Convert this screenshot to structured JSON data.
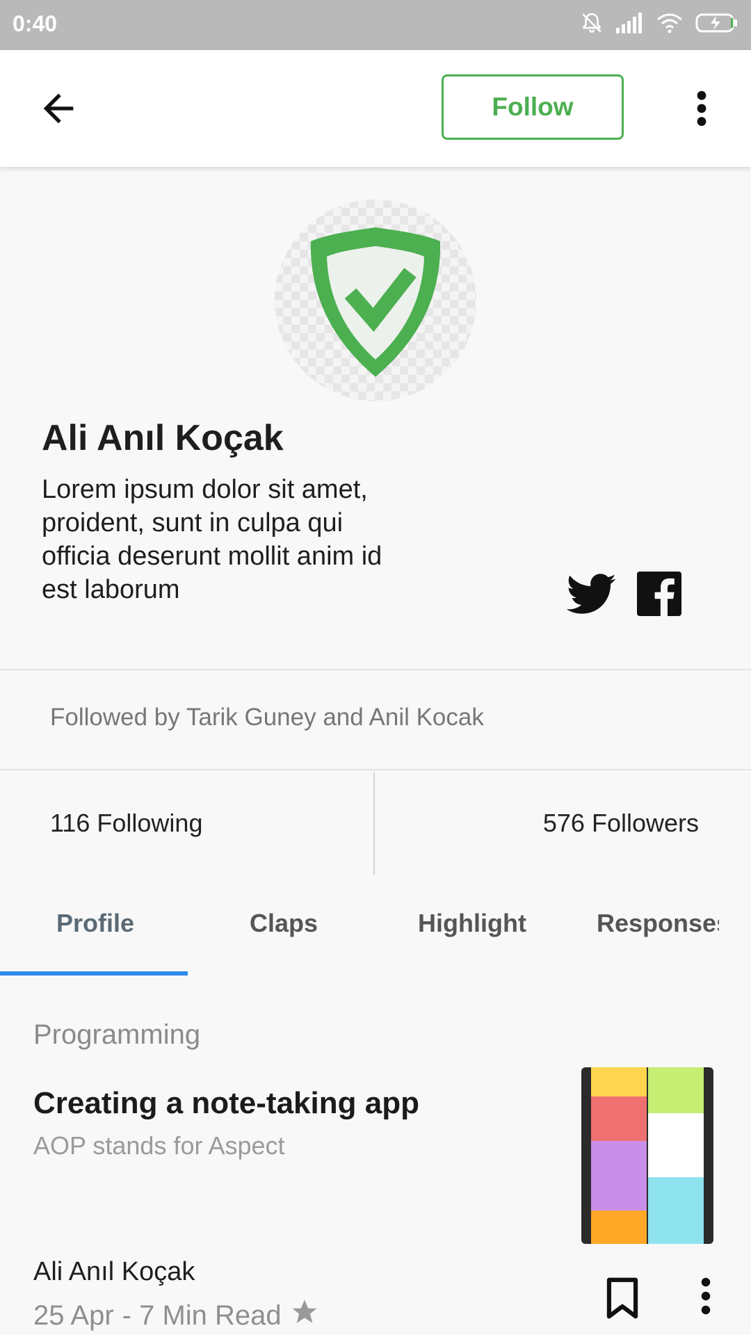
{
  "status_bar": {
    "time": "0:40",
    "icons": [
      "bell-off-icon",
      "signal-icon",
      "wifi-icon",
      "battery-charging-icon"
    ]
  },
  "app_bar": {
    "back_icon": "arrow-back-icon",
    "follow_label": "Follow",
    "more_icon": "more-vert-icon",
    "accent_color": "#4caf50"
  },
  "profile": {
    "avatar_icon": "shield-check-icon",
    "name": "Ali Anıl Koçak",
    "bio": "Lorem ipsum dolor sit amet, proident, sunt in culpa qui officia deserunt mollit anim id est laborum",
    "social": [
      "twitter-icon",
      "facebook-icon"
    ],
    "followed_by": "Followed by Tarik Guney and Anil Kocak",
    "following": "116 Following",
    "followers": "576 Followers"
  },
  "tabs": [
    {
      "label": "Profile",
      "active": true
    },
    {
      "label": "Claps",
      "active": false
    },
    {
      "label": "Highlight",
      "active": false
    },
    {
      "label": "Responses",
      "active": false
    }
  ],
  "article": {
    "category": "Programming",
    "title": "Creating a note-taking app",
    "subtitle": "AOP stands for Aspect",
    "author": "Ali Anıl Koçak",
    "date": "25 Apr",
    "read_time": "- 7 Min Read",
    "bookmark_icon": "bookmark-icon",
    "more_icon": "more-vert-icon"
  },
  "colors": {
    "tab_indicator": "#2e8be8",
    "status_bar": "#b9b9b9"
  }
}
